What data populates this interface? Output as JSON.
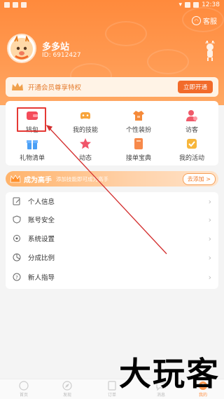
{
  "status_bar": {
    "time": "12:38"
  },
  "header": {
    "service_label": "客服",
    "username": "多多站",
    "user_id": "ID: 6912427"
  },
  "vip": {
    "text": "开通会员尊享特权",
    "button": "立即开通"
  },
  "grid": [
    {
      "label": "钱包",
      "icon": "wallet-icon",
      "color": "#f44b5a"
    },
    {
      "label": "我的技能",
      "icon": "gamepad-icon",
      "color": "#f7a43b"
    },
    {
      "label": "个性装扮",
      "icon": "shirt-icon",
      "color": "#f58a3a"
    },
    {
      "label": "访客",
      "icon": "visitor-icon",
      "color": "#f05a6a"
    },
    {
      "label": "礼物清单",
      "icon": "gift-icon",
      "color": "#4a9ff5"
    },
    {
      "label": "动态",
      "icon": "star-icon",
      "color": "#f0556a"
    },
    {
      "label": "接单宝典",
      "icon": "book-icon",
      "color": "#f7894a"
    },
    {
      "label": "我的活动",
      "icon": "activity-icon",
      "color": "#f7b63b"
    }
  ],
  "expert": {
    "title": "成为高手",
    "subtitle": "添加技能即可成为高手",
    "button": "去添加 >"
  },
  "menu": [
    {
      "label": "个人信息",
      "icon": "edit-icon"
    },
    {
      "label": "账号安全",
      "icon": "shield-icon"
    },
    {
      "label": "系统设置",
      "icon": "settings-icon"
    },
    {
      "label": "分成比例",
      "icon": "pie-chart-icon"
    },
    {
      "label": "新人指导",
      "icon": "help-icon"
    }
  ],
  "bottom_nav": [
    {
      "label": "首页",
      "icon": "home-icon"
    },
    {
      "label": "发现",
      "icon": "discover-icon"
    },
    {
      "label": "订单",
      "icon": "order-icon"
    },
    {
      "label": "消息",
      "icon": "message-icon"
    },
    {
      "label": "我的",
      "icon": "profile-icon"
    }
  ],
  "watermark": "大玩客",
  "colors": {
    "header": "#ff8f42",
    "accent": "#f26b2a",
    "highlight": "#e53935"
  }
}
